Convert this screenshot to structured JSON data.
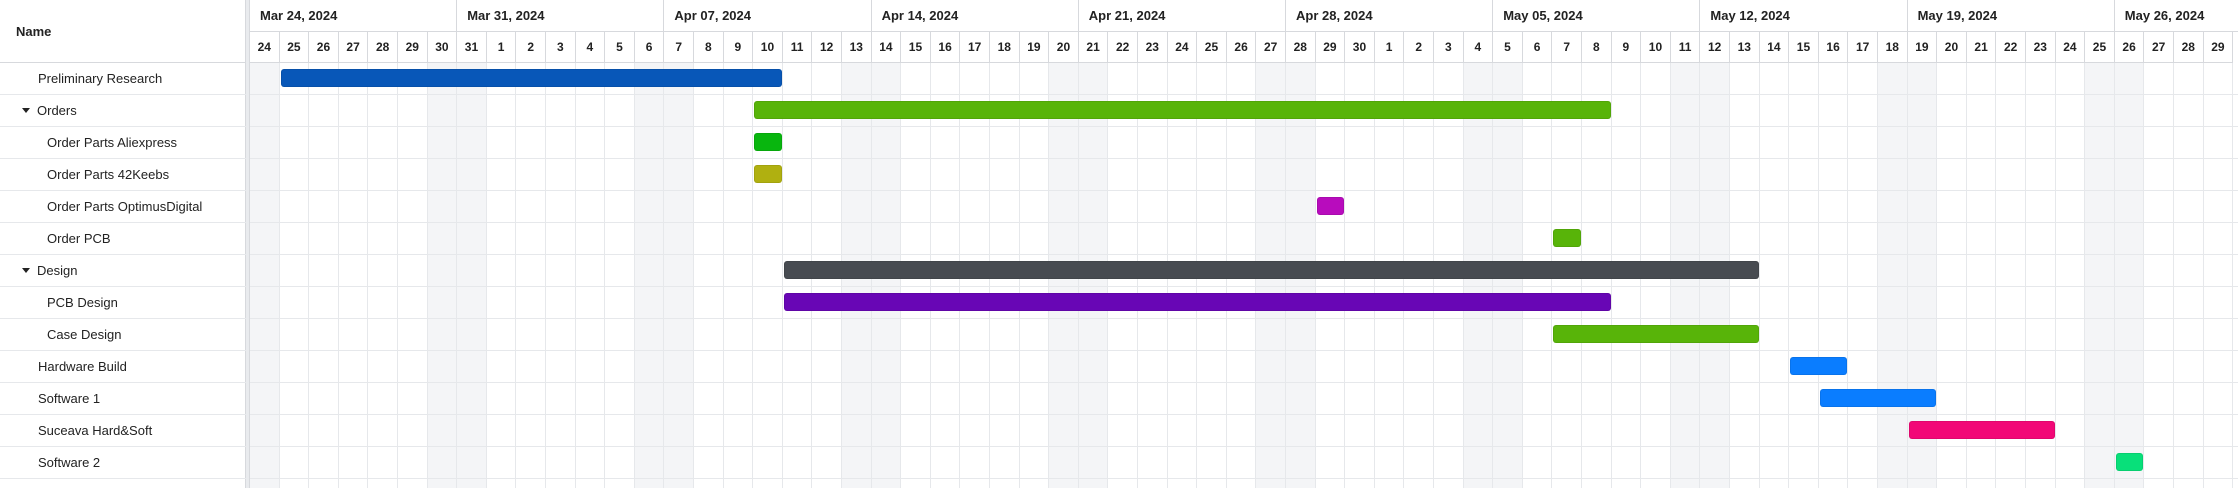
{
  "grid": {
    "header": "Name",
    "tasks": [
      {
        "name": "Preliminary Research",
        "level": 0,
        "parent": false,
        "color": "#0857b8",
        "start": "2024-03-25",
        "end": "2024-04-10"
      },
      {
        "name": "Orders",
        "level": 0,
        "parent": true,
        "color": "#58b409",
        "start": "2024-04-10",
        "end": "2024-05-08"
      },
      {
        "name": "Order Parts Aliexpress",
        "level": 1,
        "parent": false,
        "color": "#08b60e",
        "start": "2024-04-10",
        "end": "2024-04-10"
      },
      {
        "name": "Order Parts 42Keebs",
        "level": 1,
        "parent": false,
        "color": "#b0b010",
        "start": "2024-04-10",
        "end": "2024-04-10"
      },
      {
        "name": "Order Parts OptimusDigital",
        "level": 1,
        "parent": false,
        "color": "#b80cbd",
        "start": "2024-04-29",
        "end": "2024-04-29"
      },
      {
        "name": "Order PCB",
        "level": 1,
        "parent": false,
        "color": "#58b409",
        "start": "2024-05-07",
        "end": "2024-05-07"
      },
      {
        "name": "Design",
        "level": 0,
        "parent": true,
        "color": "#474b51",
        "start": "2024-04-11",
        "end": "2024-05-13"
      },
      {
        "name": "PCB Design",
        "level": 1,
        "parent": false,
        "color": "#6806b5",
        "start": "2024-04-11",
        "end": "2024-05-08"
      },
      {
        "name": "Case Design",
        "level": 1,
        "parent": false,
        "color": "#58b409",
        "start": "2024-05-07",
        "end": "2024-05-13"
      },
      {
        "name": "Hardware Build",
        "level": 0,
        "parent": false,
        "color": "#0a7dff",
        "start": "2024-05-15",
        "end": "2024-05-16"
      },
      {
        "name": "Software 1",
        "level": 0,
        "parent": false,
        "color": "#0a7dff",
        "start": "2024-05-16",
        "end": "2024-05-19"
      },
      {
        "name": "Suceava Hard&Soft",
        "level": 0,
        "parent": false,
        "color": "#f20877",
        "start": "2024-05-19",
        "end": "2024-05-23"
      },
      {
        "name": "Software 2",
        "level": 0,
        "parent": false,
        "color": "#08e07a",
        "start": "2024-05-26",
        "end": "2024-05-26"
      }
    ]
  },
  "scale": {
    "weeks": [
      "Mar 24, 2024",
      "Mar 31, 2024",
      "Apr 07, 2024",
      "Apr 14, 2024",
      "Apr 21, 2024",
      "Apr 28, 2024",
      "May 05, 2024",
      "May 12, 2024",
      "May 19, 2024",
      "May 26, 2024"
    ],
    "days": [
      "24",
      "25",
      "26",
      "27",
      "28",
      "29",
      "30",
      "31",
      "1",
      "2",
      "3",
      "4",
      "5",
      "6",
      "7",
      "8",
      "9",
      "10",
      "11",
      "12",
      "13",
      "14",
      "15",
      "16",
      "17",
      "18",
      "19",
      "20",
      "21",
      "22",
      "23",
      "24",
      "25",
      "26",
      "27",
      "28",
      "29",
      "30",
      "1",
      "2",
      "3",
      "4",
      "5",
      "6",
      "7",
      "8",
      "9",
      "10",
      "11",
      "12",
      "13",
      "14",
      "15",
      "16",
      "17",
      "18",
      "19",
      "20",
      "21",
      "22",
      "23",
      "24",
      "25",
      "26",
      "27",
      "28",
      "29"
    ],
    "first_day": "2024-03-24"
  }
}
